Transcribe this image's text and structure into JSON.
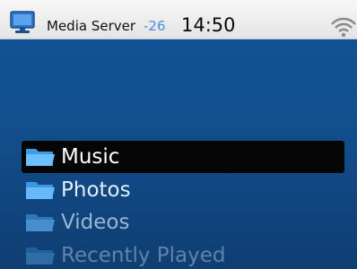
{
  "statusbar": {
    "title": "Media Server",
    "signal": "-26",
    "time": "14:50",
    "left_icon": "monitor-icon",
    "right_icon": "wifi-icon"
  },
  "menu": {
    "items": [
      {
        "label": "Music",
        "icon": "folder-icon",
        "selected": true
      },
      {
        "label": "Photos",
        "icon": "folder-icon",
        "selected": false
      },
      {
        "label": "Videos",
        "icon": "folder-icon",
        "selected": false
      },
      {
        "label": "Recently Played",
        "icon": "folder-icon",
        "selected": false
      }
    ]
  },
  "colors": {
    "background": "#0e5496",
    "selection": "#060606",
    "accent": "#4a90d6"
  }
}
